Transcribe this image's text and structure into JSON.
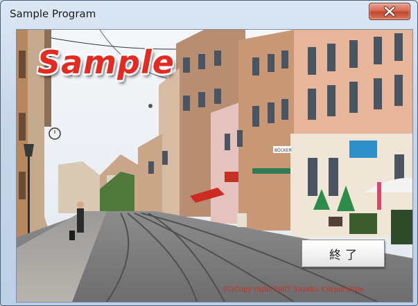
{
  "window": {
    "title": "Sample Program",
    "close_label": "X"
  },
  "content": {
    "logo_text": "Sample",
    "exit_button_label": "終了",
    "copyright": "(C)Copy right 2007 Suzaku Corporation",
    "shop_sign": "BÖCKER"
  },
  "colors": {
    "logo": "#e32b22",
    "copyright": "#d22a1e",
    "close_button": "#c2452b"
  },
  "icons": {
    "close": "close-icon"
  }
}
